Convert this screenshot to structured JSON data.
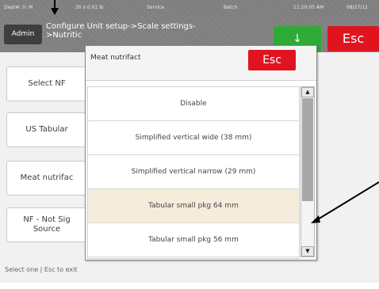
{
  "status_bar": {
    "dept": "Dept#: 0: M",
    "scale": "30 x 0.01 lb",
    "mode": "Service",
    "batch": "Batch",
    "time": "11:20:05 AM",
    "date": "08/27/12"
  },
  "header": {
    "admin_label": "Admin",
    "breadcrumb": "Configure Unit setup->Scale settings-\n>Nutritic",
    "ok_label": "↓",
    "esc_label": "Esc"
  },
  "sidebar": {
    "items": [
      {
        "label": "Select NF"
      },
      {
        "label": "US Tabular"
      },
      {
        "label": "Meat nutrifac"
      },
      {
        "label": "NF - Not Sig\nSource"
      }
    ]
  },
  "dialog": {
    "title": "Meat nutrifact",
    "esc_label": "Esc",
    "options": [
      {
        "label": "Disable",
        "selected": false
      },
      {
        "label": "Simplified vertical wide (38 mm)",
        "selected": false
      },
      {
        "label": "Simplified vertical narrow (29 mm)",
        "selected": false
      },
      {
        "label": "Tabular small pkg 64 mm",
        "selected": true
      },
      {
        "label": "Tabular small pkg 56 mm",
        "selected": false
      }
    ],
    "scroll_up": "▲",
    "scroll_down": "▼"
  },
  "footer": {
    "hint": "Select one | Esc to exit"
  },
  "colors": {
    "esc_red": "#e0141f",
    "ok_green": "#2faa36",
    "selected_row": "#f5ecdc"
  }
}
